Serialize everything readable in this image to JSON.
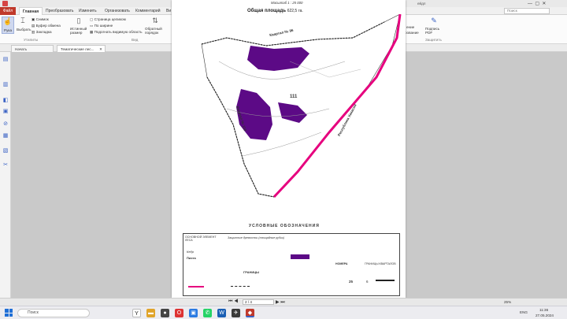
{
  "title_bar": {
    "right_text": "ейдл"
  },
  "tabs": {
    "file": "Файл",
    "home": "Главная",
    "convert": "Преобразовать",
    "edit": "Изменить",
    "organize": "Организовать",
    "comment": "Комментарий",
    "more": "Ви",
    "search_placeholder": "Поиск"
  },
  "ribbon": {
    "hand": "Рука",
    "select": "Выбрать",
    "snapshot": "Снимок",
    "clipboard": "Буфер обмена",
    "bookmark": "Закладка",
    "tools_group": "Утилиты",
    "actual_size": "Истинный размер",
    "page_whole": "Страница целиком",
    "fit_width": "По ширине",
    "fit_visible": "Подогнать видимую область",
    "view_group": "Вид",
    "reverse_order": "Обратный порядок",
    "sign_pdf": "Подпись PDF",
    "protect_group": "Защитить",
    "compare_partial": "ение",
    "compare_partial2": "рование"
  },
  "doc_tabs": {
    "start": "Начать",
    "thematic": "Тематические лес..."
  },
  "map": {
    "scale": "Масштаб 1 : 25 000",
    "total_area_label": "Общая площадь",
    "total_area_value": "622,5",
    "area_unit": "га.",
    "quarter_96": "Квартал № 96",
    "quarter_110": "Квартал № 110",
    "republic": "Республика Хакасия",
    "block_number": "111",
    "legend_title": "УСЛОВНЫЕ ОБОЗНАЧЕНИЯ",
    "legend_header1": "ОСНОВНОЙ ЭЛЕМЕНТ ЛЕСА",
    "legend_header2": "Защитные древостои (площадные рубки)",
    "kedr": "Кедр",
    "pikhta": "Пихта",
    "numbers": "НОМЕРА",
    "borders_label": "ГРАНИЦЫ КВАРТАЛОВ",
    "borders": "ГРАНИЦЫ",
    "num_25": "25",
    "num_6": "6"
  },
  "nav": {
    "page_value": "2 / 4",
    "zoom": "25%"
  },
  "taskbar": {
    "search": "Поиск",
    "lang": "ENG",
    "time": "11:36",
    "date": "27.05.2024"
  },
  "colors": {
    "forest_purple": "#5c0a86",
    "border_pink": "#e6007e",
    "accent": "#c0392b"
  }
}
